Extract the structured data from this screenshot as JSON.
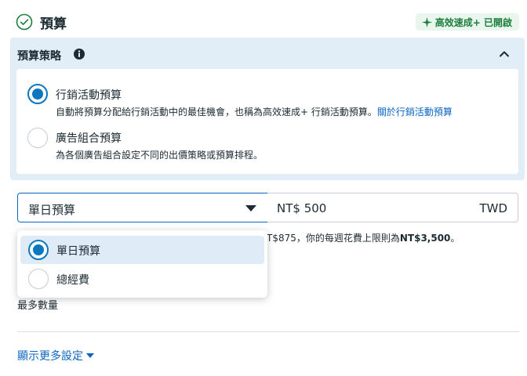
{
  "header": {
    "title": "預算",
    "badge": "高效速成+ 已開啟"
  },
  "strategy": {
    "title": "預算策略",
    "options": [
      {
        "title": "行銷活動預算",
        "description": "自動將預算分配給行銷活動中的最佳機會，也稱為高效速成+ 行銷活動預算。",
        "link": "關於行銷活動預算",
        "selected": true
      },
      {
        "title": "廣告組合預算",
        "description": "為各個廣告組合設定不同的出價策略或預算排程。",
        "selected": false
      }
    ]
  },
  "budget": {
    "type_selected": "單日預算",
    "amount": "NT$ 500",
    "currency": "TWD"
  },
  "spend_note": {
    "prefix": "T$875，你的每週花費上限則為",
    "amount": "NT$3,500",
    "suffix": "。"
  },
  "dropdown": {
    "items": [
      {
        "label": "單日預算",
        "selected": true
      },
      {
        "label": "總經費",
        "selected": false
      }
    ]
  },
  "max_quantity_label": "最多數量",
  "show_more_label": "顯示更多設定",
  "colors": {
    "accent": "#0a78be",
    "link": "#0a66c2",
    "panel_bg": "#e1edf7",
    "badge_bg": "#e9f6ee",
    "badge_text": "#1b7d3c"
  }
}
